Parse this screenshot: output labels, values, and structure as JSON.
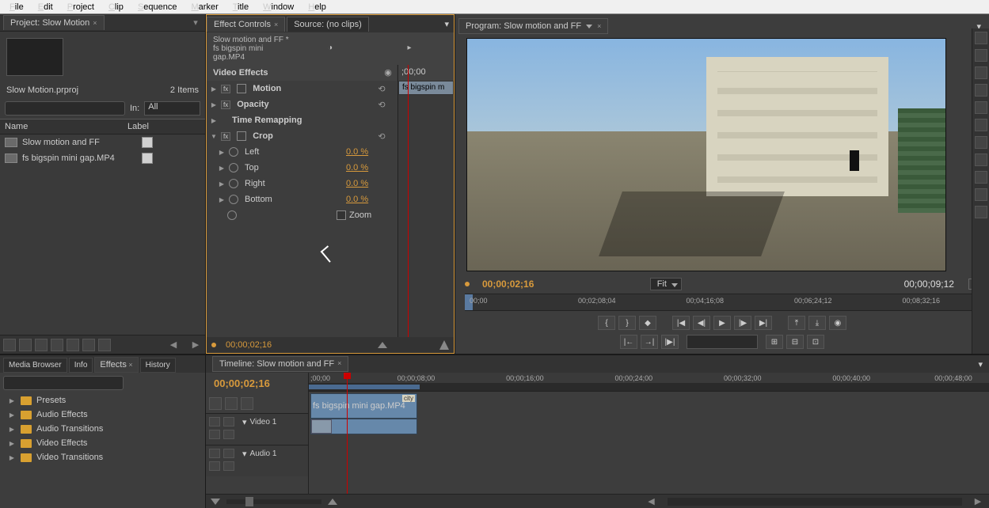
{
  "menu": [
    "File",
    "Edit",
    "Project",
    "Clip",
    "Sequence",
    "Marker",
    "Title",
    "Window",
    "Help"
  ],
  "project": {
    "tab": "Project: Slow Motion",
    "filename": "Slow Motion.prproj",
    "item_count": "2 Items",
    "in_label": "In:",
    "in_value": "All",
    "col_name": "Name",
    "col_label": "Label",
    "bins": [
      {
        "name": "Slow motion and FF"
      },
      {
        "name": "fs bigspin mini gap.MP4"
      }
    ]
  },
  "effect_controls": {
    "tab_ec": "Effect Controls",
    "tab_src": "Source: (no clips)",
    "header": "Slow motion and FF * fs bigspin mini gap.MP4",
    "ruler_tc": ";00;00",
    "clip_chip": "fs bigspin m",
    "section": "Video Effects",
    "fx": [
      {
        "name": "Motion",
        "reset": true,
        "fx": true,
        "box": true
      },
      {
        "name": "Opacity",
        "reset": true,
        "fx": true
      },
      {
        "name": "Time Remapping"
      },
      {
        "name": "Crop",
        "reset": true,
        "fx": true,
        "box": true,
        "open": true
      }
    ],
    "crop": [
      {
        "name": "Left",
        "val": "0.0 %"
      },
      {
        "name": "Top",
        "val": "0.0 %"
      },
      {
        "name": "Right",
        "val": "0.0 %"
      },
      {
        "name": "Bottom",
        "val": "0.0 %"
      }
    ],
    "zoom_label": "Zoom",
    "footer_tc": "00;00;02;16"
  },
  "program": {
    "tab": "Program: Slow motion and FF",
    "tc_left": "00;00;02;16",
    "fit": "Fit",
    "tc_right": "00;00;09;12",
    "ruler": [
      "00;00",
      "00;02;08;04",
      "00;04;16;08",
      "00;06;24;12",
      "00;08;32;16"
    ]
  },
  "effects_panel": {
    "tabs": [
      "Media Browser",
      "Info",
      "Effects",
      "History"
    ],
    "folders": [
      "Presets",
      "Audio Effects",
      "Audio Transitions",
      "Video Effects",
      "Video Transitions"
    ]
  },
  "timeline": {
    "tab": "Timeline: Slow motion and FF",
    "tc": "00;00;02;16",
    "ruler": [
      ";00;00",
      "00;00;08;00",
      "00;00;16;00",
      "00;00;24;00",
      "00;00;32;00",
      "00;00;40;00",
      "00;00;48;00"
    ],
    "video_track": "Video 1",
    "audio_track": "Audio 1",
    "clip_name": "fs bigspin mini gap.MP4",
    "clip_tag": "city"
  }
}
